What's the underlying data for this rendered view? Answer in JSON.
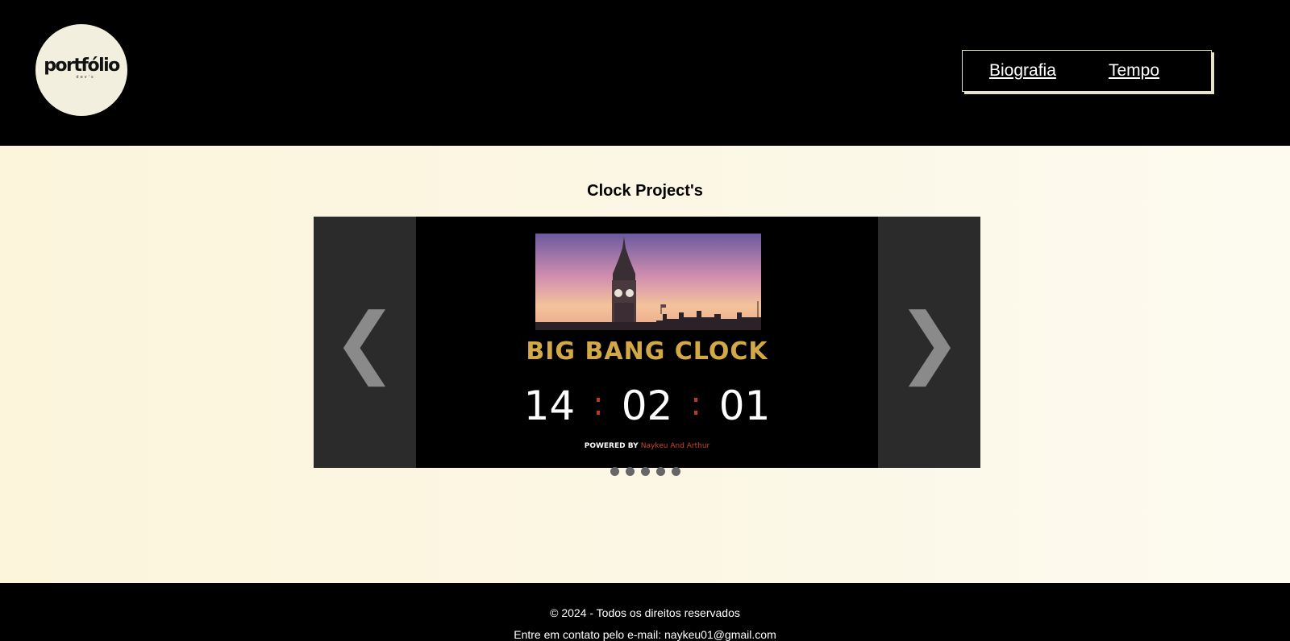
{
  "header": {
    "logo": {
      "word": "portfólio",
      "sub": "dev's"
    },
    "nav": [
      {
        "label": "Biografia"
      },
      {
        "label": "Tempo"
      }
    ]
  },
  "main": {
    "title": "Clock Project's",
    "carousel": {
      "prev_icon": "❮",
      "next_icon": "❯",
      "slide": {
        "brand": "BIG BANG CLOCK",
        "time": {
          "hours": "14",
          "minutes": "02",
          "seconds": "01",
          "separator": ":"
        },
        "powered_label": "POWERED BY",
        "powered_by": "Naykeu And Arthur"
      },
      "dot_count": 5
    }
  },
  "footer": {
    "copyright": "© 2024 - Todos os direitos reservados",
    "contact": "Entre em contato pelo e-mail: naykeu01@gmail.com"
  },
  "colors": {
    "header_bg": "#000000",
    "body_bg": "#fcf7e4",
    "accent_gold": "#d3a948",
    "clock_separator": "#b83a2a"
  }
}
